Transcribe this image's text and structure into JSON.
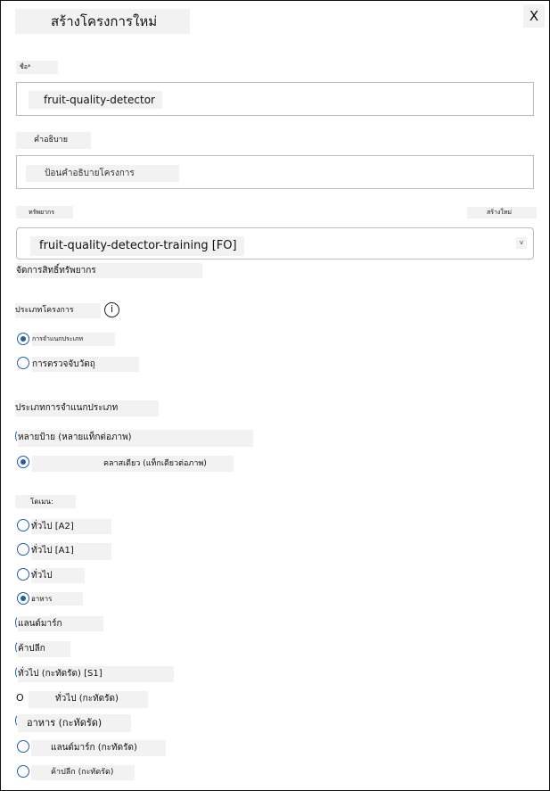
{
  "dialog": {
    "title": "สร้างโครงการใหม่",
    "close_label": "X"
  },
  "name": {
    "label": "ชื่อ*",
    "value": "fruit-quality-detector"
  },
  "description": {
    "label": "คำอธิบาย",
    "placeholder": "ป้อนคำอธิบายโครงการ"
  },
  "resource": {
    "label": "ทรัพยากร",
    "create_new": "สร้างใหม่",
    "selected": "fruit-quality-detector-training [FO]",
    "chevron": "v",
    "manage_link": "จัดการสิทธิ์ทรัพยากร"
  },
  "project_type": {
    "label": "ประเภทโครงการ",
    "info_glyph": "i",
    "options": [
      {
        "label": "การจำแนกประเภท",
        "checked": true
      },
      {
        "label": "การตรวจจับวัตถุ",
        "checked": false
      }
    ]
  },
  "classification_type": {
    "label": "ประเภทการจำแนกประเภท",
    "options": [
      {
        "label": "หลายป้าย (หลายแท็กต่อภาพ)",
        "checked": false
      },
      {
        "label": "คลาสเดียว (แท็กเดียวต่อภาพ)",
        "checked": true
      }
    ]
  },
  "domains": {
    "label": "โดเมน:",
    "options": [
      {
        "label": "ทั่วไป [A2]",
        "checked": false
      },
      {
        "label": "ทั่วไป [A1]",
        "checked": false
      },
      {
        "label": "ทั่วไป",
        "checked": false
      },
      {
        "label": "อาหาร",
        "checked": true
      },
      {
        "label": "แลนด์มาร์ก",
        "checked": false
      },
      {
        "label": "ค้าปลีก",
        "checked": false
      },
      {
        "label": "ทั่วไป (กะทัดรัด) [S1]",
        "checked": false
      },
      {
        "label": "ทั่วไป (กะทัดรัด)",
        "checked": false,
        "marker": "O"
      },
      {
        "label": "อาหาร (กะทัดรัด)",
        "checked": false
      },
      {
        "label": "แลนด์มาร์ก (กะทัดรัด)",
        "checked": false
      },
      {
        "label": "ค้าปลีก (กะทัดรัด)",
        "checked": false
      }
    ]
  }
}
